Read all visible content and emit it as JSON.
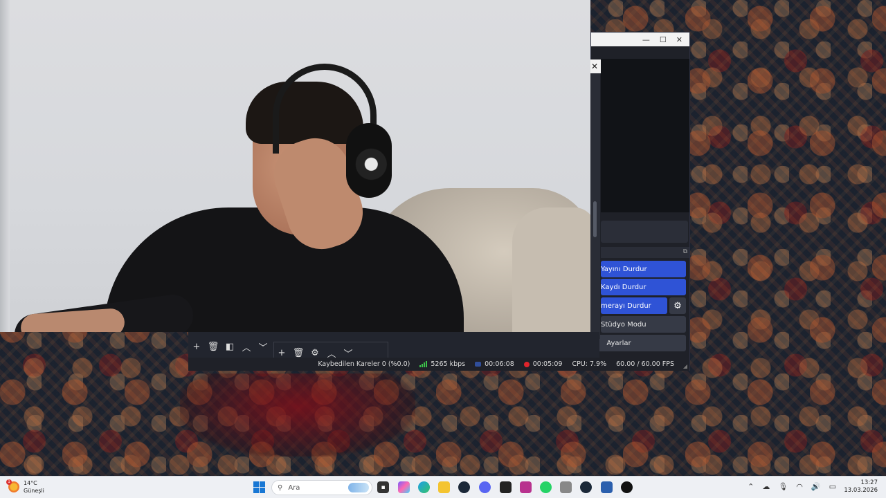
{
  "obs": {
    "controls": {
      "stop_stream": "Yayını Durdur",
      "stop_record": "Kaydı Durdur",
      "stop_camera": "merayı Durdur",
      "studio_mode": "Stüdyo Modu",
      "settings": "Ayarlar"
    },
    "status": {
      "dropped_frames": "Kaybedilen Kareler 0 (%0.0)",
      "bitrate": "5265 kbps",
      "stream_time": "00:06:08",
      "record_time": "00:05:09",
      "cpu": "CPU: 7.9%",
      "fps": "60.00 / 60.00 FPS"
    },
    "accent_color": "#2f53d6"
  },
  "taskbar": {
    "weather_temp": "14°C",
    "weather_desc": "Güneşli",
    "weather_badge": "1",
    "search_placeholder": "Ara",
    "clock_time": "13:27",
    "clock_date": "13.03.2026"
  }
}
